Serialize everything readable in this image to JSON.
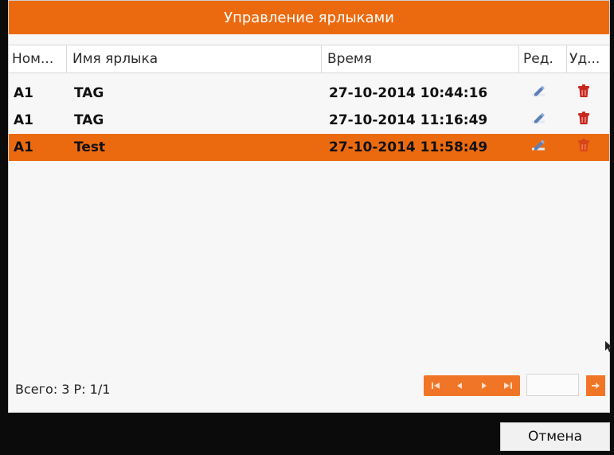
{
  "dialog": {
    "title": "Управление ярлыками"
  },
  "table": {
    "columns": [
      "Ном...",
      "Имя ярлыка",
      "Время",
      "Ред.",
      "Уд..."
    ],
    "rows": [
      {
        "num": "A1",
        "name": "TAG",
        "time": "27-10-2014 10:44:16",
        "selected": false
      },
      {
        "num": "A1",
        "name": "TAG",
        "time": "27-10-2014 11:16:49",
        "selected": false
      },
      {
        "num": "A1",
        "name": "Test",
        "time": "27-10-2014 11:58:49",
        "selected": true
      }
    ],
    "edit_icon": "edit-pencil-icon",
    "delete_icon": "trash-icon"
  },
  "footer": {
    "summary": "Всего: 3 P: 1/1",
    "pager_icons": [
      "first-page-icon",
      "prev-page-icon",
      "next-page-icon",
      "last-page-icon"
    ],
    "go_icon": "go-arrow-icon"
  },
  "actions": {
    "cancel_label": "Отмена"
  },
  "colors": {
    "accent": "#ec6a0f",
    "delete_icon": "#c8281e"
  }
}
